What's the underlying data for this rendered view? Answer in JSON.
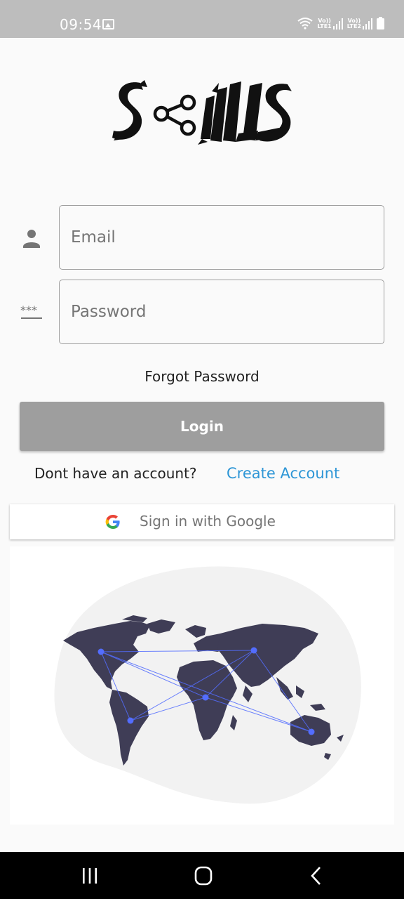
{
  "status_bar": {
    "time": "09:54",
    "icons": [
      "gallery-icon",
      "wifi-icon",
      "volte-lte1-signal-icon",
      "volte-lte2-signal-icon",
      "battery-icon"
    ],
    "lte1_label": "LTE1",
    "lte2_label": "LTE2",
    "volte_label": "Vo))"
  },
  "logo": {
    "alt": "Skills"
  },
  "login_form": {
    "email": {
      "placeholder": "Email",
      "value": "",
      "icon": "person-icon"
    },
    "password": {
      "placeholder": "Password",
      "value": "",
      "icon": "password-icon"
    },
    "forgot_password": "Forgot Password",
    "login_button": "Login",
    "no_account_text": "Dont have an account?",
    "create_account_link": "Create Account",
    "google_button": "Sign in with Google",
    "google_icon": "google-icon"
  },
  "illustration": {
    "name": "world-map-network-illustration"
  },
  "nav_bar": {
    "buttons": [
      "recent-apps-icon",
      "home-icon",
      "back-icon"
    ]
  },
  "colors": {
    "status_bar": "#bdbdbd",
    "background": "#fafafa",
    "login_button": "#9e9e9e",
    "link": "#2e96d6",
    "map_land": "#3f3d56",
    "map_blob": "#f2f2f2",
    "network": "#536dfe",
    "nav_bar": "#000000"
  }
}
